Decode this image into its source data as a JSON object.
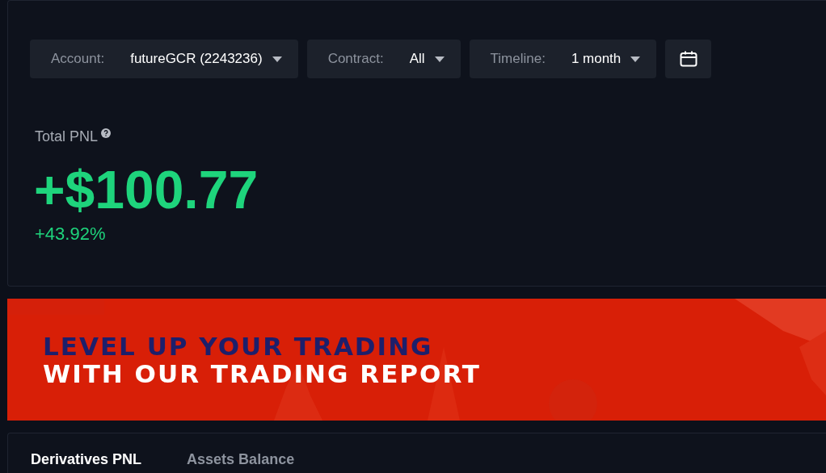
{
  "filters": [
    {
      "label": "Account:",
      "value": "futureGCR (2243236)"
    },
    {
      "label": "Contract:",
      "value": "All"
    },
    {
      "label": "Timeline:",
      "value": "1 month"
    }
  ],
  "total_pnl": {
    "label": "Total PNL",
    "amount": "+$100.77",
    "percent": "+43.92%"
  },
  "banner": {
    "headline": "LEVEL UP YOUR TRADING",
    "subheadline": "WITH OUR TRADING REPORT"
  },
  "tabs": [
    {
      "label": "Derivatives PNL",
      "selected": true
    },
    {
      "label": "Assets Balance",
      "selected": false
    }
  ]
}
